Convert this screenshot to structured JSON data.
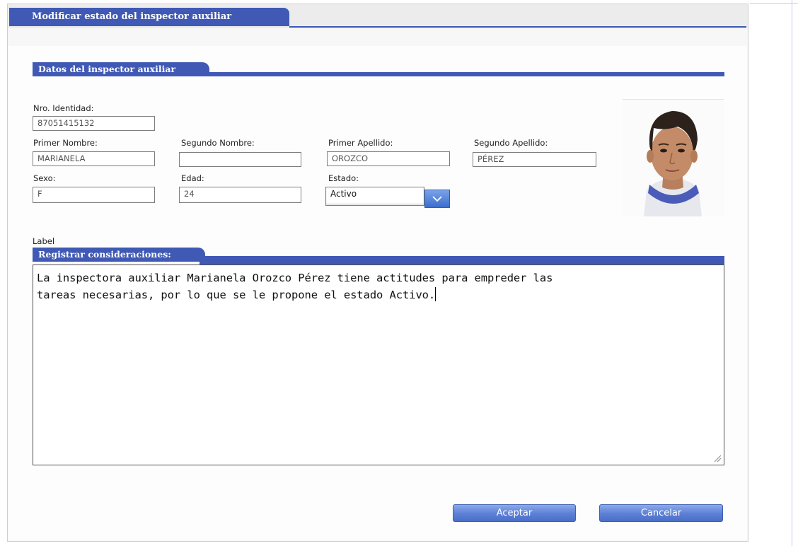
{
  "dialog": {
    "title": "Modificar estado del inspector auxiliar"
  },
  "section_datos": {
    "title": "Datos del inspector auxiliar"
  },
  "fields": {
    "identidad": {
      "label": "Nro. Identidad:",
      "value": "87051415132"
    },
    "primer_nombre": {
      "label": "Primer Nombre:",
      "value": "MARIANELA"
    },
    "segundo_nombre": {
      "label": "Segundo Nombre:",
      "value": ""
    },
    "primer_apellido": {
      "label": "Primer Apellido:",
      "value": "OROZCO"
    },
    "segundo_apellido": {
      "label": "Segundo Apellido:",
      "value": "PÉREZ"
    },
    "sexo": {
      "label": "Sexo:",
      "value": "F"
    },
    "edad": {
      "label": "Edad:",
      "value": "24"
    },
    "estado": {
      "label": "Estado:",
      "value": "Activo"
    }
  },
  "label_text": "Label",
  "section_consideraciones": {
    "title": "Registrar consideraciones:",
    "text": "La inspectora auxiliar Marianela Orozco Pérez tiene actitudes para empreder las\ntareas necesarias, por lo que se le propone el estado Activo."
  },
  "buttons": {
    "accept": "Aceptar",
    "cancel": "Cancelar"
  },
  "colors": {
    "accent": "#3f59b4",
    "button": "#5b7fd6"
  },
  "icons": {
    "select_arrow": "chevron-down-icon",
    "photo": "person-photo"
  }
}
